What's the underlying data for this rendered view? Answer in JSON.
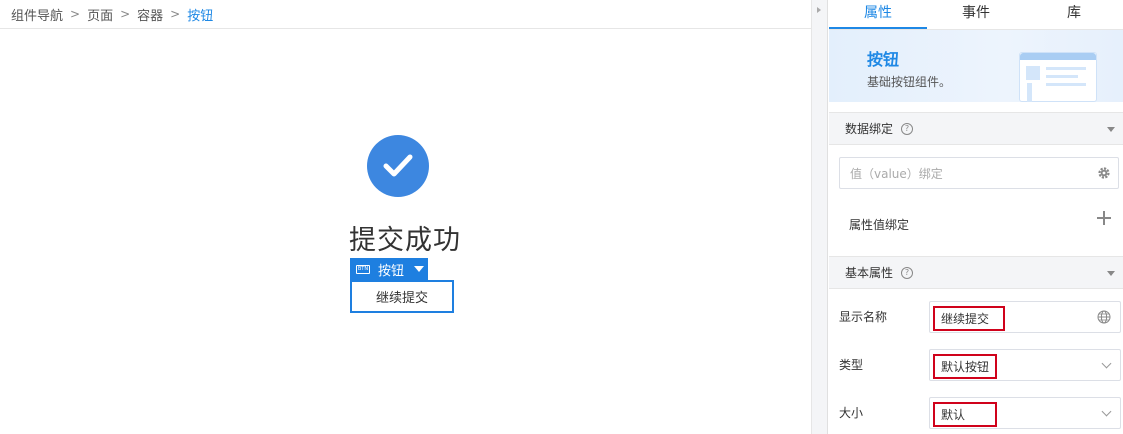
{
  "breadcrumb": {
    "items": [
      "组件导航",
      "页面",
      "容器",
      "按钮"
    ],
    "separator": ">"
  },
  "canvas": {
    "title": "提交成功",
    "component_tag": {
      "glyph": "BTN",
      "label": "按钮"
    },
    "selected_button_label": "继续提交"
  },
  "panel": {
    "tabs": [
      "属性",
      "事件",
      "库"
    ],
    "active_tab": "属性",
    "banner": {
      "title": "按钮",
      "description": "基础按钮组件。"
    },
    "data_binding": {
      "header": "数据绑定",
      "help_glyph": "?",
      "value_placeholder": "值（value）绑定",
      "attr_bind_label": "属性值绑定"
    },
    "basic_props": {
      "header": "基本属性",
      "help_glyph": "?",
      "display_name": {
        "label": "显示名称",
        "value": "继续提交"
      },
      "type": {
        "label": "类型",
        "value": "默认按钮"
      },
      "size": {
        "label": "大小",
        "value": "默认"
      }
    }
  },
  "colors": {
    "accent": "#1e88e5",
    "success": "#3d87e0",
    "highlight": "#d0021b"
  },
  "icons": [
    "chevron-right-icon",
    "check-icon",
    "btn-icon",
    "caret-down-icon",
    "help-icon",
    "gear-icon",
    "plus-icon",
    "globe-icon",
    "chevron-down-icon"
  ]
}
